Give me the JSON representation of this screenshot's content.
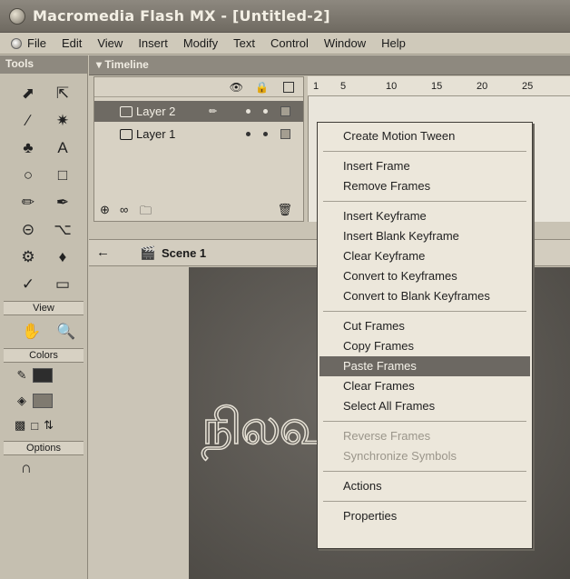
{
  "window": {
    "title": "Macromedia Flash MX - [Untitled-2]"
  },
  "menubar": {
    "items": [
      "File",
      "Edit",
      "View",
      "Insert",
      "Modify",
      "Text",
      "Control",
      "Window",
      "Help"
    ]
  },
  "tools": {
    "title": "Tools",
    "icons": [
      "arrow-icon",
      "subselect-icon",
      "line-icon",
      "lasso-icon",
      "pen-icon",
      "text-icon",
      "oval-icon",
      "rectangle-icon",
      "pencil-icon",
      "brush-icon",
      "free-transform-icon",
      "fill-transform-icon",
      "ink-bottle-icon",
      "paint-bucket-icon",
      "eyedropper-icon",
      "eraser-icon"
    ],
    "view_label": "View",
    "colors_label": "Colors",
    "options_label": "Options"
  },
  "timeline": {
    "title": "Timeline",
    "ruler_ticks": [
      "1",
      "5",
      "10",
      "15",
      "20",
      "25"
    ],
    "layers": [
      {
        "name": "Layer 2",
        "selected": true
      },
      {
        "name": "Layer 1",
        "selected": false
      }
    ]
  },
  "scene": {
    "label": "Scene 1"
  },
  "context_menu": {
    "groups": [
      [
        {
          "label": "Create Motion Tween",
          "state": "normal"
        }
      ],
      [
        {
          "label": "Insert Frame",
          "state": "normal"
        },
        {
          "label": "Remove Frames",
          "state": "normal"
        }
      ],
      [
        {
          "label": "Insert Keyframe",
          "state": "normal"
        },
        {
          "label": "Insert Blank Keyframe",
          "state": "normal"
        },
        {
          "label": "Clear Keyframe",
          "state": "normal"
        },
        {
          "label": "Convert to Keyframes",
          "state": "normal"
        },
        {
          "label": "Convert to Blank Keyframes",
          "state": "normal"
        }
      ],
      [
        {
          "label": "Cut Frames",
          "state": "normal"
        },
        {
          "label": "Copy Frames",
          "state": "normal"
        },
        {
          "label": "Paste Frames",
          "state": "highlight"
        },
        {
          "label": "Clear Frames",
          "state": "normal"
        },
        {
          "label": "Select All Frames",
          "state": "normal"
        }
      ],
      [
        {
          "label": "Reverse Frames",
          "state": "disabled"
        },
        {
          "label": "Synchronize Symbols",
          "state": "disabled"
        }
      ],
      [
        {
          "label": "Actions",
          "state": "normal"
        }
      ],
      [
        {
          "label": "Properties",
          "state": "normal"
        }
      ]
    ]
  },
  "colors": {
    "selection": "#6c6862",
    "titlebar": "#7d786f"
  }
}
